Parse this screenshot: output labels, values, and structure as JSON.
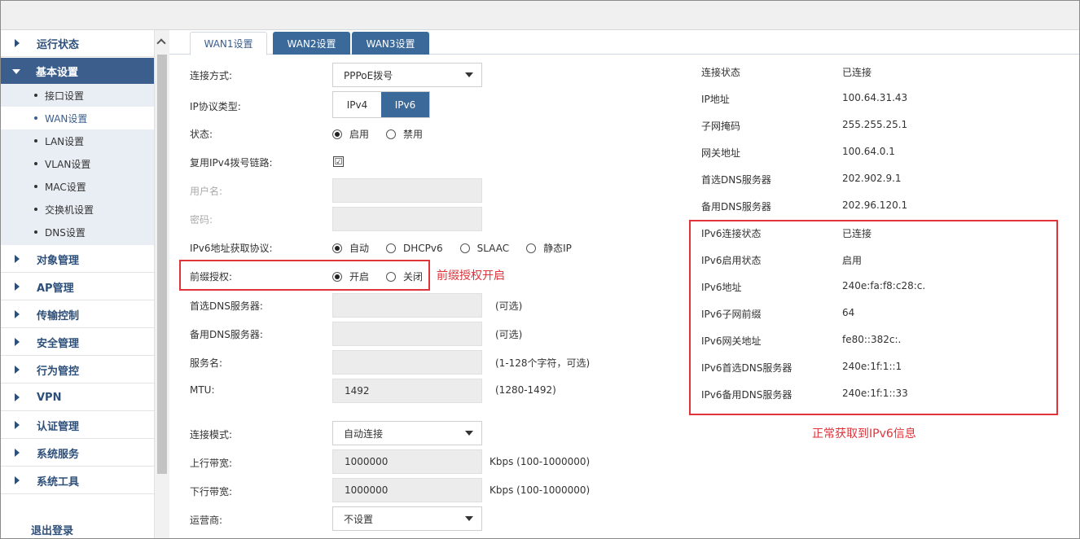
{
  "sidebar": {
    "items": [
      {
        "label": "运行状态"
      },
      {
        "label": "基本设置"
      },
      {
        "label": "对象管理"
      },
      {
        "label": "AP管理"
      },
      {
        "label": "传输控制"
      },
      {
        "label": "安全管理"
      },
      {
        "label": "行为管控"
      },
      {
        "label": "VPN"
      },
      {
        "label": "认证管理"
      },
      {
        "label": "系统服务"
      },
      {
        "label": "系统工具"
      }
    ],
    "sub_items": [
      "接口设置",
      "WAN设置",
      "LAN设置",
      "VLAN设置",
      "MAC设置",
      "交换机设置",
      "DNS设置"
    ],
    "logout": "退出登录"
  },
  "tabs": [
    "WAN1设置",
    "WAN2设置",
    "WAN3设置"
  ],
  "form": {
    "connection_type_label": "连接方式:",
    "connection_type_value": "PPPoE拨号",
    "ip_protocol_label": "IP协议类型:",
    "ip_protocol_options": [
      "IPv4",
      "IPv6"
    ],
    "status_label": "状态:",
    "status_options": [
      "启用",
      "禁用"
    ],
    "reuse_label": "复用IPv4拨号链路:",
    "reuse_checked": "☑",
    "username_label": "用户名:",
    "password_label": "密码:",
    "ipv6_proto_label": "IPv6地址获取协议:",
    "ipv6_proto_options": [
      "自动",
      "DHCPv6",
      "SLAAC",
      "静态IP"
    ],
    "prefix_label": "前缀授权:",
    "prefix_options": [
      "开启",
      "关闭"
    ],
    "primary_dns_label": "首选DNS服务器:",
    "secondary_dns_label": "备用DNS服务器:",
    "optional_hint": "(可选)",
    "service_label": "服务名:",
    "service_hint": "(1-128个字符，可选)",
    "mtu_label": "MTU:",
    "mtu_value": "1492",
    "mtu_hint": "(1280-1492)",
    "conn_mode_label": "连接模式:",
    "conn_mode_value": "自动连接",
    "upload_label": "上行带宽:",
    "upload_value": "1000000",
    "bandwidth_hint": "Kbps (100-1000000)",
    "download_label": "下行带宽:",
    "download_value": "1000000",
    "isp_label": "运营商:",
    "isp_value": "不设置"
  },
  "annotations": {
    "prefix_note": "前缀授权开启",
    "ipv6_note": "正常获取到IPv6信息"
  },
  "status": [
    {
      "label": "连接状态",
      "value": "已连接"
    },
    {
      "label": "IP地址",
      "value": "100.64.31.43"
    },
    {
      "label": "子网掩码",
      "value": "255.255.25.1"
    },
    {
      "label": "网关地址",
      "value": "100.64.0.1"
    },
    {
      "label": "首选DNS服务器",
      "value": "202.902.9.1"
    },
    {
      "label": "备用DNS服务器",
      "value": "202.96.120.1"
    },
    {
      "label": "IPv6连接状态",
      "value": "已连接"
    },
    {
      "label": "IPv6启用状态",
      "value": "启用"
    },
    {
      "label": "IPv6地址",
      "value": "240e:fa:f8:c28:c."
    },
    {
      "label": "IPv6子网前缀",
      "value": "64"
    },
    {
      "label": "IPv6网关地址",
      "value": "fe80::382c:."
    },
    {
      "label": "IPv6首选DNS服务器",
      "value": "240e:1f:1::1"
    },
    {
      "label": "IPv6备用DNS服务器",
      "value": "240e:1f:1::33"
    }
  ]
}
